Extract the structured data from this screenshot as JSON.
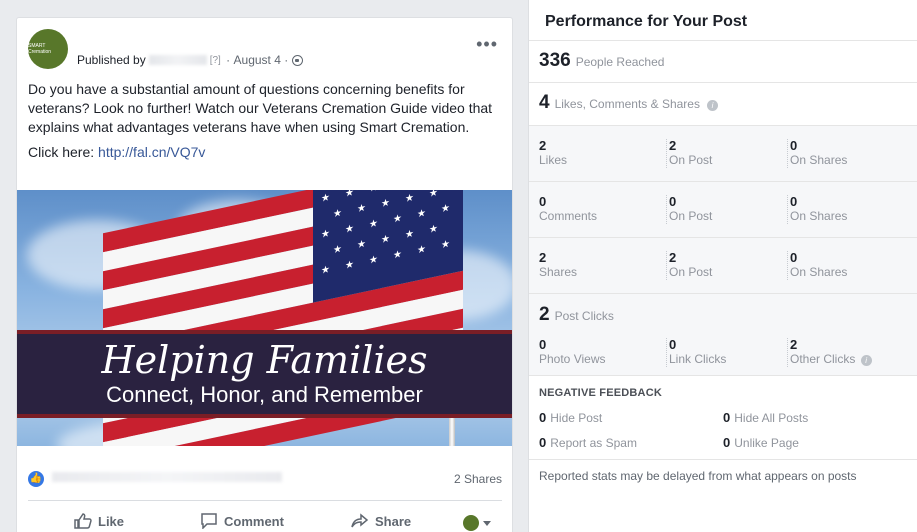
{
  "post": {
    "published_by_label": "Published by",
    "help_marker": "[?]",
    "date": "August 4",
    "avatar_text": "SMART Cremation",
    "paragraph": "Do you have a substantial amount of questions concerning benefits for veterans? Look no further! Watch our Veterans Cremation Guide video that explains what advantages veterans have when using Smart Cremation.",
    "click_label": "Click here:",
    "link": "http://fal.cn/VQ7v",
    "image_title": "Helping Families",
    "image_subtitle": "Connect, Honor, and Remember",
    "shares": "2 Shares",
    "actions": {
      "like": "Like",
      "comment": "Comment",
      "share": "Share"
    }
  },
  "performance": {
    "title": "Performance for Your Post",
    "reach": {
      "value": "336",
      "label": "People Reached"
    },
    "engagement": {
      "value": "4",
      "label": "Likes, Comments & Shares"
    },
    "rows": [
      {
        "total": "2",
        "total_label": "Likes",
        "on_post": "2",
        "on_post_label": "On Post",
        "on_shares": "0",
        "on_shares_label": "On Shares"
      },
      {
        "total": "0",
        "total_label": "Comments",
        "on_post": "0",
        "on_post_label": "On Post",
        "on_shares": "0",
        "on_shares_label": "On Shares"
      },
      {
        "total": "2",
        "total_label": "Shares",
        "on_post": "2",
        "on_post_label": "On Post",
        "on_shares": "0",
        "on_shares_label": "On Shares"
      }
    ],
    "clicks": {
      "value": "2",
      "label": "Post Clicks",
      "photo_views": "0",
      "photo_views_label": "Photo Views",
      "link_clicks": "0",
      "link_clicks_label": "Link Clicks",
      "other_clicks": "2",
      "other_clicks_label": "Other Clicks"
    },
    "negative": {
      "title": "NEGATIVE FEEDBACK",
      "hide_post": "0",
      "hide_post_label": "Hide Post",
      "hide_all": "0",
      "hide_all_label": "Hide All Posts",
      "spam": "0",
      "spam_label": "Report as Spam",
      "unlike": "0",
      "unlike_label": "Unlike Page"
    },
    "footnote": "Reported stats may be delayed from what appears on posts"
  },
  "colors": {
    "facebook_blue": "#3578e5",
    "link": "#385898",
    "banner": "#2a2240"
  }
}
